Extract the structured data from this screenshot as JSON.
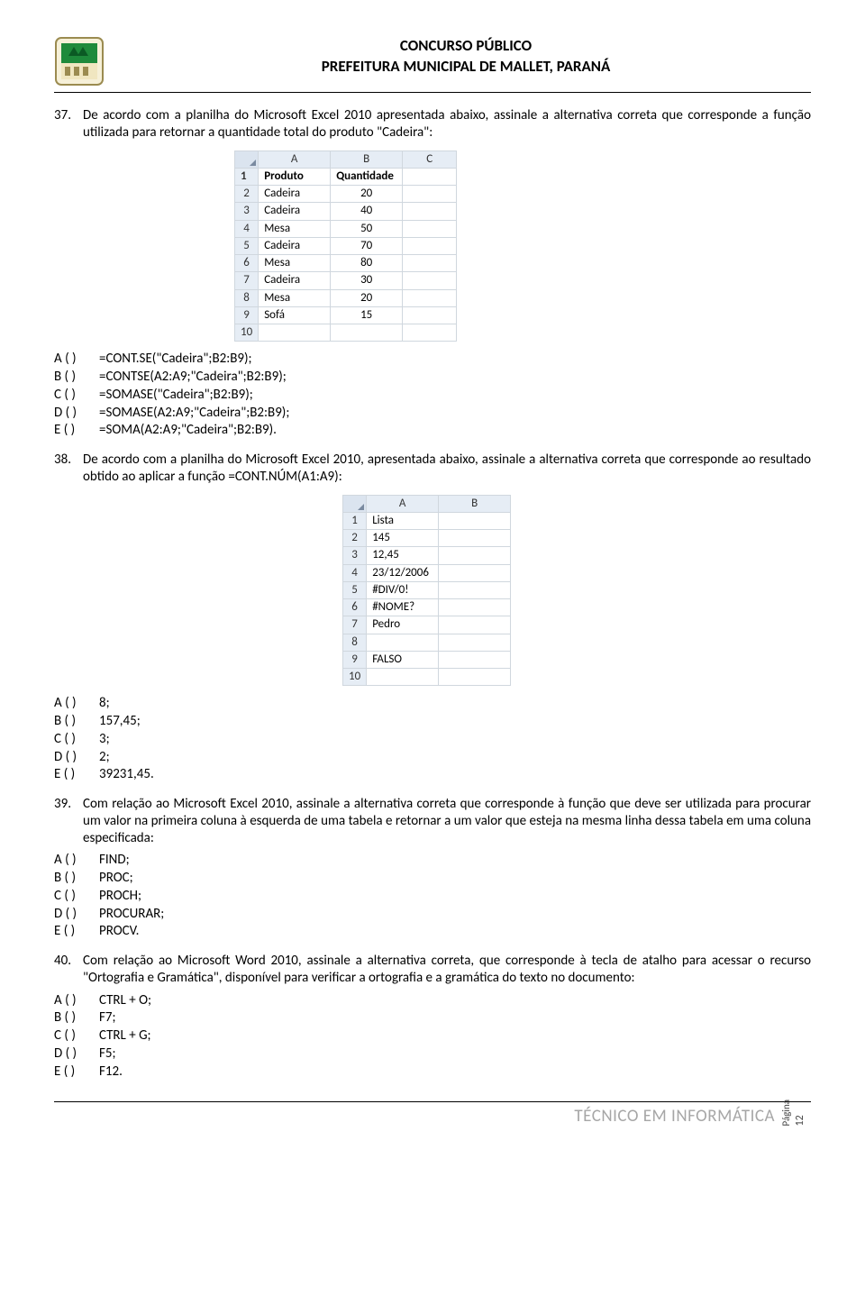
{
  "header": {
    "line1": "CONCURSO PÚBLICO",
    "line2": "PREFEITURA MUNICIPAL DE MALLET, PARANÁ"
  },
  "q37": {
    "num": "37.",
    "text": "De acordo com a planilha do Microsoft Excel 2010 apresentada abaixo, assinale a alternativa correta que corresponde a função utilizada para retornar a quantidade total do produto \"Cadeira\":",
    "table": {
      "cols": [
        "A",
        "B",
        "C"
      ],
      "rows": [
        {
          "n": "1",
          "a": "Produto",
          "b": "Quantidade",
          "c": "",
          "hdr": true
        },
        {
          "n": "2",
          "a": "Cadeira",
          "b": "20",
          "c": ""
        },
        {
          "n": "3",
          "a": "Cadeira",
          "b": "40",
          "c": ""
        },
        {
          "n": "4",
          "a": "Mesa",
          "b": "50",
          "c": ""
        },
        {
          "n": "5",
          "a": "Cadeira",
          "b": "70",
          "c": ""
        },
        {
          "n": "6",
          "a": "Mesa",
          "b": "80",
          "c": ""
        },
        {
          "n": "7",
          "a": "Cadeira",
          "b": "30",
          "c": ""
        },
        {
          "n": "8",
          "a": "Mesa",
          "b": "20",
          "c": ""
        },
        {
          "n": "9",
          "a": "Sofá",
          "b": "15",
          "c": ""
        },
        {
          "n": "10",
          "a": "",
          "b": "",
          "c": ""
        }
      ]
    },
    "opts": {
      "a": "=CONT.SE(\"Cadeira\";B2:B9);",
      "b": "=CONTSE(A2:A9;\"Cadeira\";B2:B9);",
      "c": "=SOMASE(\"Cadeira\";B2:B9);",
      "d": "=SOMASE(A2:A9;\"Cadeira\";B2:B9);",
      "e": "=SOMA(A2:A9;\"Cadeira\";B2:B9)."
    }
  },
  "q38": {
    "num": "38.",
    "text": "De acordo com a planilha do Microsoft Excel 2010, apresentada abaixo, assinale a alternativa correta que corresponde ao resultado obtido ao aplicar a função =CONT.NÚM(A1:A9):",
    "table": {
      "cols": [
        "A",
        "B"
      ],
      "rows": [
        {
          "n": "1",
          "a": "Lista",
          "b": ""
        },
        {
          "n": "2",
          "a": "145",
          "b": ""
        },
        {
          "n": "3",
          "a": "12,45",
          "b": ""
        },
        {
          "n": "4",
          "a": "23/12/2006",
          "b": ""
        },
        {
          "n": "5",
          "a": "#DIV/0!",
          "b": ""
        },
        {
          "n": "6",
          "a": "#NOME?",
          "b": ""
        },
        {
          "n": "7",
          "a": "Pedro",
          "b": ""
        },
        {
          "n": "8",
          "a": "",
          "b": ""
        },
        {
          "n": "9",
          "a": "FALSO",
          "b": ""
        },
        {
          "n": "10",
          "a": "",
          "b": ""
        }
      ]
    },
    "opts": {
      "a": "8;",
      "b": "157,45;",
      "c": "3;",
      "d": "2;",
      "e": "39231,45."
    }
  },
  "q39": {
    "num": "39.",
    "text": "Com relação ao Microsoft Excel 2010, assinale a alternativa correta que corresponde à função que deve ser utilizada para procurar um valor na primeira coluna à esquerda de uma tabela e retornar a um valor que esteja na mesma linha dessa tabela em uma coluna especificada:",
    "opts": {
      "a": "FIND;",
      "b": "PROC;",
      "c": "PROCH;",
      "d": "PROCURAR;",
      "e": "PROCV."
    }
  },
  "q40": {
    "num": "40.",
    "text": "Com relação ao Microsoft Word 2010, assinale a alternativa correta, que corresponde à tecla de atalho para acessar o recurso \"Ortografia e Gramática\", disponível para verificar a ortografia e a gramática do texto no documento:",
    "opts": {
      "a": "CTRL + O;",
      "b": "F7;",
      "c": "CTRL + G;",
      "d": "F5;",
      "e": "F12."
    }
  },
  "labels": {
    "a": "A (   )",
    "b": "B (   )",
    "c": "C (   )",
    "d": "D (   )",
    "e": "E (   )"
  },
  "footer": {
    "role": "TÉCNICO EM INFORMÁTICA",
    "page_label": "Página",
    "page_num": "12"
  }
}
